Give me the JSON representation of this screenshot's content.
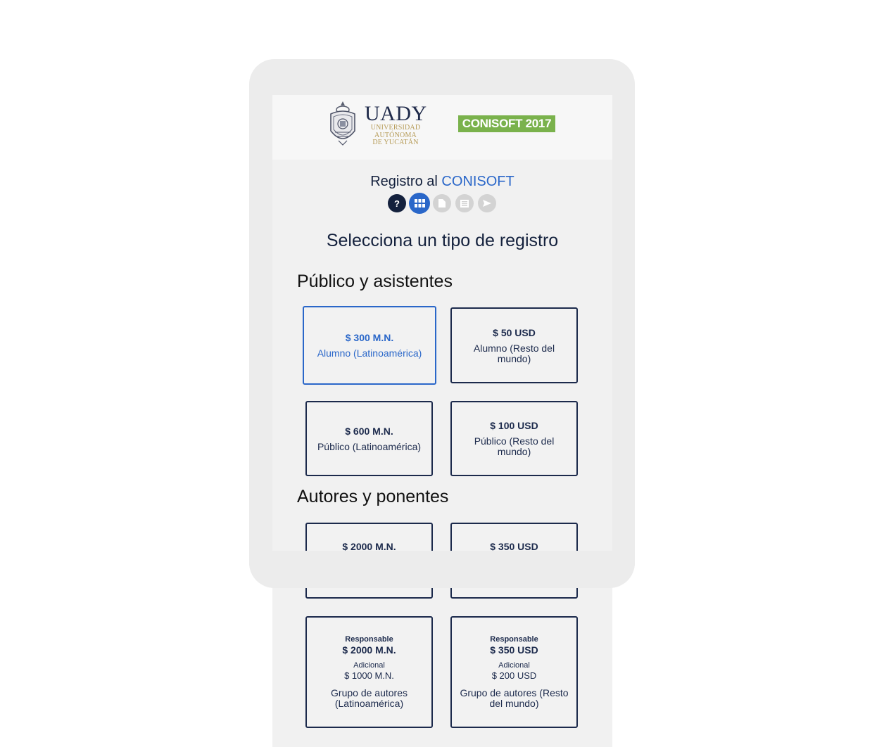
{
  "header": {
    "logo_name": "UADY",
    "logo_subtitle": [
      "UNIVERSIDAD",
      "AUTÓNOMA",
      "DE YUCATÁN"
    ],
    "event_badge": "CONISOFT 2017",
    "badge_color": "#7ab24c"
  },
  "registration": {
    "title_prefix": "Registro al",
    "title_accent": "CONISOFT",
    "accent_color": "#2a67c9",
    "steps": [
      {
        "icon": "question-icon",
        "glyph": "?",
        "state": "done"
      },
      {
        "icon": "grid-icon",
        "state": "current"
      },
      {
        "icon": "document-icon",
        "state": "pending"
      },
      {
        "icon": "list-icon",
        "state": "pending"
      },
      {
        "icon": "send-icon",
        "state": "pending"
      }
    ],
    "section_title": "Selecciona un tipo de registro"
  },
  "groups": {
    "public": {
      "title": "Público y asistentes",
      "cards": [
        {
          "price": "$ 300 M.N.",
          "label": "Alumno (Latinoamérica)",
          "selected": true
        },
        {
          "price": "$ 50 USD",
          "label": "Alumno (Resto del mundo)",
          "selected": false
        },
        {
          "price": "$ 600 M.N.",
          "label": "Público (Latinoamérica)",
          "selected": false
        },
        {
          "price": "$ 100 USD",
          "label": "Público (Resto del mundo)",
          "selected": false
        }
      ]
    },
    "authors": {
      "title": "Autores y ponentes",
      "cards": [
        {
          "price": "$ 2000 M.N."
        },
        {
          "price": "$ 350 USD"
        }
      ],
      "group_cards": [
        {
          "resp_label": "Responsable",
          "resp_price": "$ 2000 M.N.",
          "add_label": "Adicional",
          "add_price": "$ 1000 M.N.",
          "label": "Grupo de autores (Latinoamérica)"
        },
        {
          "resp_label": "Responsable",
          "resp_price": "$ 350 USD",
          "add_label": "Adicional",
          "add_price": "$ 200 USD",
          "label": "Grupo de autores (Resto del mundo)"
        }
      ]
    }
  }
}
